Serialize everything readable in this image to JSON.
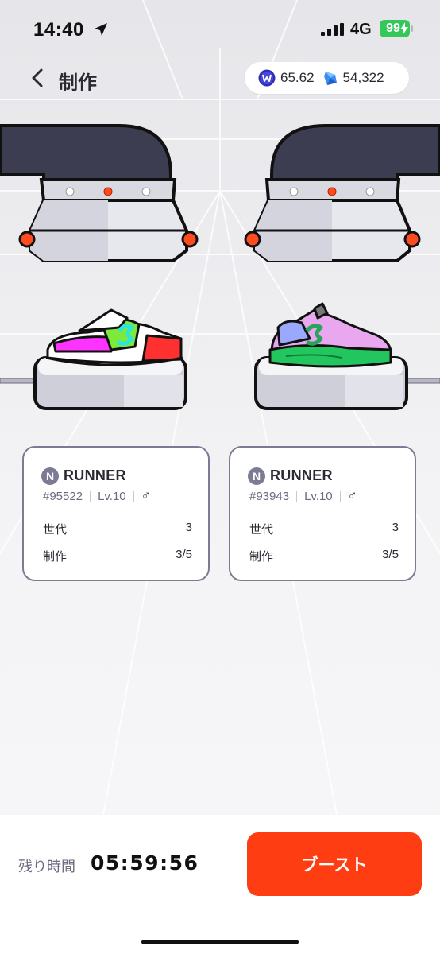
{
  "status_bar": {
    "time": "14:40",
    "network": "4G",
    "battery": "99"
  },
  "header": {
    "title": "制作",
    "wallet": {
      "coin_icon": "coin-w-icon",
      "coin_value": "65.62",
      "gem_icon": "gem-icon",
      "gem_value": "54,322"
    }
  },
  "parents": [
    {
      "rarity": "N",
      "type": "RUNNER",
      "id": "#95522",
      "level": "Lv.10",
      "gender_symbol": "♂",
      "generation_label": "世代",
      "generation_value": "3",
      "mint_label": "制作",
      "mint_value": "3/5",
      "shoe_colors": [
        "#ff33ff",
        "#7bea3a",
        "#ff3030",
        "#2ee6d6"
      ]
    },
    {
      "rarity": "N",
      "type": "RUNNER",
      "id": "#93943",
      "level": "Lv.10",
      "gender_symbol": "♂",
      "generation_label": "世代",
      "generation_value": "3",
      "mint_label": "制作",
      "mint_value": "3/5",
      "shoe_colors": [
        "#22c55e",
        "#e9a7f0",
        "#9aa8ff",
        "#26a65b"
      ]
    }
  ],
  "bottom": {
    "timer_label": "残り時間",
    "timer_value": "05:59:56",
    "boost_label": "ブースト"
  },
  "colors": {
    "accent": "#ff3d12",
    "machine_dark": "#3d3d52",
    "card_border": "#7b7b93",
    "battery": "#34c759"
  }
}
